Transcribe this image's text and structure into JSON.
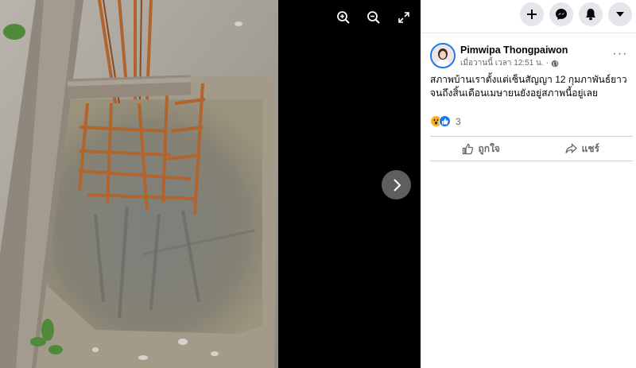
{
  "viewer": {
    "zoom_in_icon": "zoom-in-icon",
    "zoom_out_icon": "zoom-out-icon",
    "fullscreen_icon": "fullscreen-icon",
    "next_icon": "chevron-right-icon"
  },
  "topbar": {
    "create_icon": "plus-icon",
    "messenger_icon": "messenger-icon",
    "notifications_icon": "bell-icon",
    "account_icon": "caret-down-icon"
  },
  "post": {
    "author": "Pimwipa Thongpaiwon",
    "timestamp": "เมื่อวานนี้ เวลา 12:51 น.",
    "separator": "·",
    "privacy_icon": "globe-icon",
    "text": "สภาพบ้านเราตั้งแต่เซ็นสัญญา 12 กุมภาพันธ์ยาวจนถึงสิ้นเดือนเมษายนยังอยู่สภาพนี้อยู่เลย",
    "more_label": "···",
    "reaction_count": "3",
    "like_label": "ถูกใจ",
    "share_label": "แชร์"
  },
  "colors": {
    "accent": "#1877f2",
    "muted_text": "#65676b",
    "panel_bg": "#ffffff",
    "viewer_bg": "#000000"
  }
}
